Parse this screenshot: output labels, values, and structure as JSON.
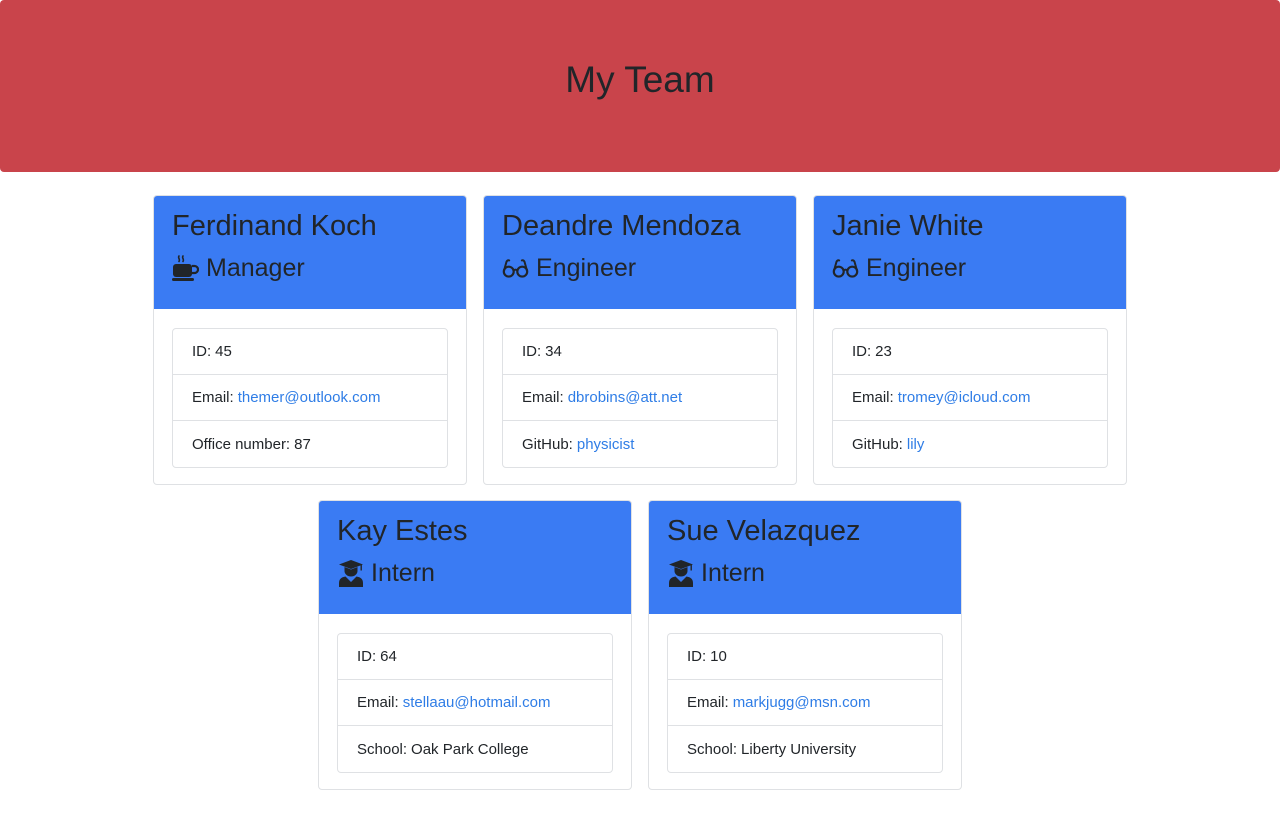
{
  "header": {
    "title": "My Team"
  },
  "team": [
    {
      "name": "Ferdinand Koch",
      "role": "Manager",
      "role_icon": "mug-icon",
      "id_label": "ID:",
      "id": "45",
      "email_label": "Email:",
      "email": "themer@outlook.com",
      "extra_label": "Office number:",
      "extra_value": "87"
    },
    {
      "name": "Deandre Mendoza",
      "role": "Engineer",
      "role_icon": "glasses-icon",
      "id_label": "ID:",
      "id": "34",
      "email_label": "Email:",
      "email": "dbrobins@att.net",
      "extra_label": "GitHub:",
      "extra_value": "physicist"
    },
    {
      "name": "Janie White",
      "role": "Engineer",
      "role_icon": "glasses-icon",
      "id_label": "ID:",
      "id": "23",
      "email_label": "Email:",
      "email": "tromey@icloud.com",
      "extra_label": "GitHub:",
      "extra_value": "lily"
    },
    {
      "name": "Kay Estes",
      "role": "Intern",
      "role_icon": "graduate-icon",
      "id_label": "ID:",
      "id": "64",
      "email_label": "Email:",
      "email": "stellaau@hotmail.com",
      "extra_label": "School:",
      "extra_value": "Oak Park College"
    },
    {
      "name": "Sue Velazquez",
      "role": "Intern",
      "role_icon": "graduate-icon",
      "id_label": "ID:",
      "id": "10",
      "email_label": "Email:",
      "email": "markjugg@msn.com",
      "extra_label": "School:",
      "extra_value": "Liberty University"
    }
  ],
  "colors": {
    "header_bg": "#c9444b",
    "card_header_bg": "#3a7bf3",
    "link": "#2f7de6",
    "text": "#212529",
    "border": "#dfe1e4"
  }
}
